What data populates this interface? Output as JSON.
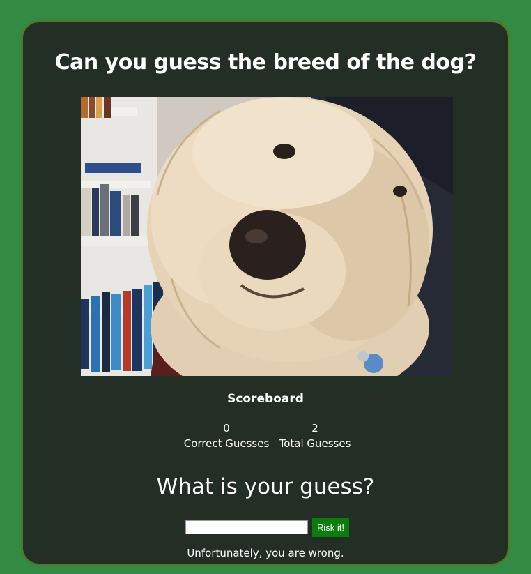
{
  "page": {
    "title": "Can you guess the breed of the dog?"
  },
  "image": {
    "alt": "Photo of a fluffy cream-colored dog"
  },
  "scoreboard": {
    "title": "Scoreboard",
    "correct_value": "0",
    "correct_label": "Correct Guesses",
    "total_value": "2",
    "total_label": "Total Guesses"
  },
  "guess": {
    "heading": "What is your guess?",
    "input_value": "",
    "button_label": "Risk it!",
    "result": "Unfortunately, you are wrong."
  },
  "colors": {
    "page_background": "#338a42",
    "card_background": "#232f24",
    "card_border": "#4f7a2e",
    "button_background": "#0a7d0a"
  }
}
